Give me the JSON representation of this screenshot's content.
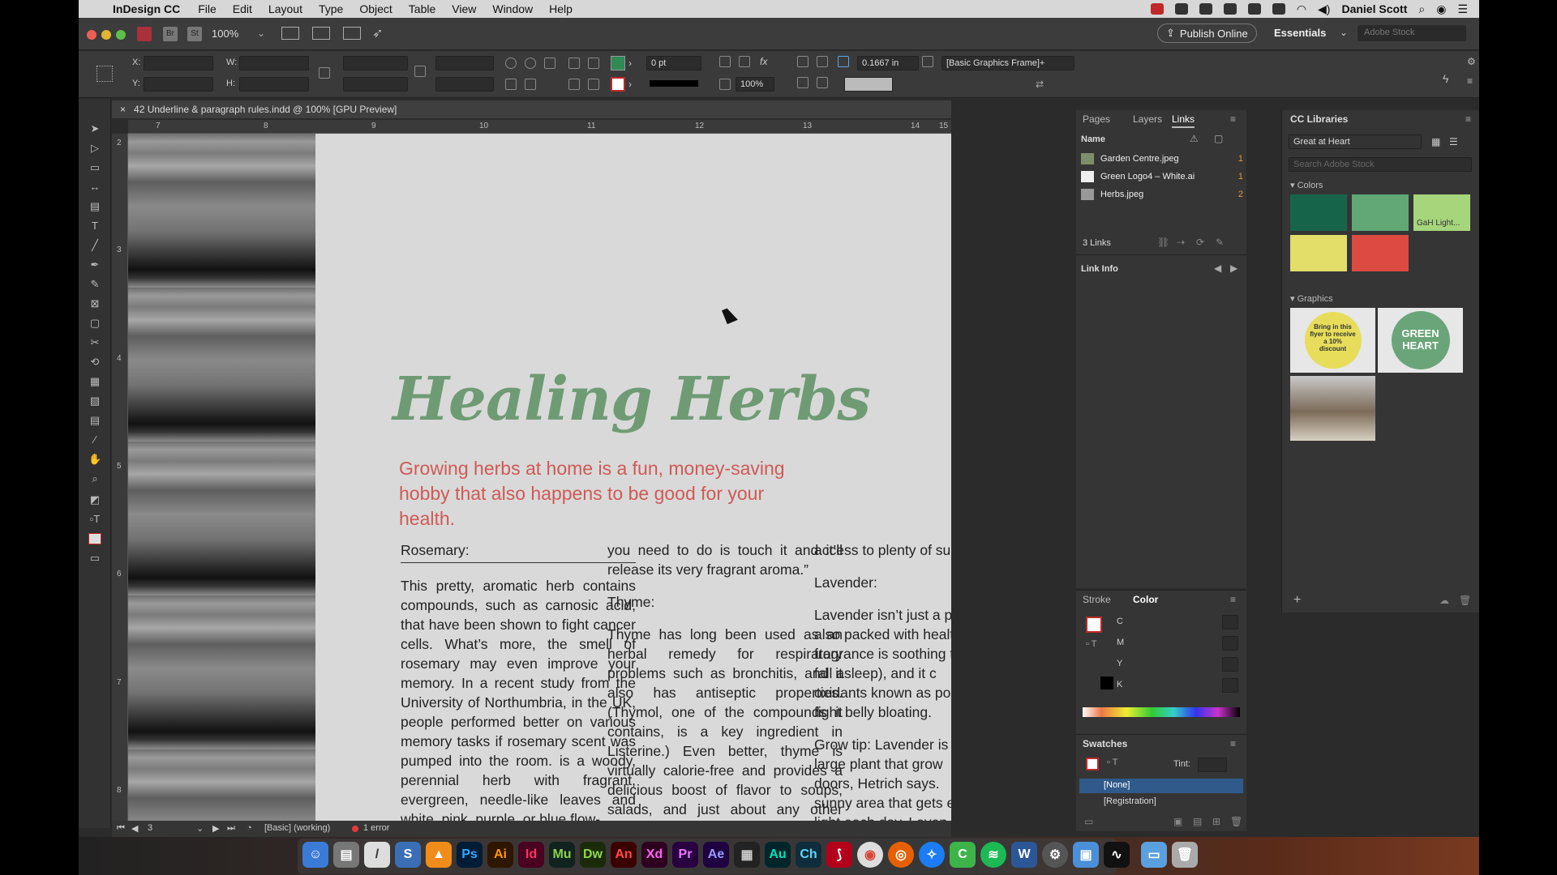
{
  "menubar": {
    "app_name": "InDesign CC",
    "items": [
      "File",
      "Edit",
      "Layout",
      "Type",
      "Object",
      "Table",
      "View",
      "Window",
      "Help"
    ],
    "user": "Daniel Scott"
  },
  "appbar": {
    "zoom": "100%",
    "publish_label": "Publish Online",
    "workspace": "Essentials",
    "stock_placeholder": "Adobe Stock"
  },
  "control": {
    "x_label": "X:",
    "y_label": "Y:",
    "w_label": "W:",
    "h_label": "H:",
    "stroke_weight": "0 pt",
    "opacity": "100%",
    "gap_value": "0.1667 in",
    "object_style": "[Basic Graphics Frame]+"
  },
  "document": {
    "tab_title": "42 Underline & paragraph rules.indd @ 100% [GPU Preview]",
    "ruler_top": [
      "7",
      "8",
      "9",
      "10",
      "11",
      "12",
      "13",
      "14",
      "15"
    ],
    "ruler_left": [
      "2",
      "3",
      "4",
      "5",
      "6",
      "7",
      "8"
    ],
    "title": "Healing Herbs",
    "subtitle": "Growing herbs at home is a fun, money-saving hobby that also happens to be good for your health.",
    "col1": {
      "heading": "Rosemary:",
      "body": "This pretty, aromatic herb contains compounds, such as carnosic acid, that have been shown to fight cancer cells. What’s more, the smell of rosemary may even improve your memory. In a recent study from the University of Northumbria, in the UK, people performed better on various memory tasks if rosemary scent was pumped into the room. is a woody, perennial herb with fragrant, evergreen, needle-like leaves and white, pink, purple, or blue flow-"
    },
    "col2": {
      "lead": "you need to do is touch it and it’ll release its very fragrant aroma.”",
      "heading": "Thyme:",
      "body": "Thyme has long been used as an herbal remedy for respiratory problems such as bronchitis, and it also has antiseptic properties. (Thymol, one of the compounds it contains, is a key ingredient in Listerine.) Even better, thyme is virtually calorie-free and provides a delicious boost of flavor to soups, salads, and just about any other recipe you can"
    },
    "col3": {
      "lead": "access to plenty of sun",
      "heading": "Lavender:",
      "body": "Lavender isn’t just a pre also packed with health fragrance is soothing to fall asleep), and it c oxidants known as poly fight belly bloating.",
      "grow_tip": "Grow tip: Lavender is large plant that grow doors, Hetrich says. sunny area that gets e light each day. Laven"
    }
  },
  "status": {
    "page": "3",
    "preflight_profile": "[Basic] (working)",
    "errors": "1 error"
  },
  "links_panel": {
    "tabs": [
      "Pages",
      "Layers",
      "Links"
    ],
    "name_header": "Name",
    "links": [
      {
        "name": "Garden Centre.jpeg",
        "page": "1"
      },
      {
        "name": "Green Logo4 – White.ai",
        "page": "1"
      },
      {
        "name": "Herbs.jpeg",
        "page": "2"
      }
    ],
    "count": "3 Links",
    "link_info": "Link Info"
  },
  "libraries": {
    "title": "CC Libraries",
    "library": "Great at Heart",
    "search_placeholder": "Search Adobe Stock",
    "colors_label": "Colors",
    "swatches": [
      "#16654a",
      "#62a877",
      "#a6d57c",
      "#e3dd6a",
      "#dc4a42"
    ],
    "swatch_tooltip": "GaH Light...",
    "graphics_label": "Graphics",
    "badge_text": "Bring in this flyer to receive a 10% discount",
    "logo_text": "GREEN HEART"
  },
  "stroke_color": {
    "tabs": [
      "Stroke",
      "Color"
    ],
    "channels": [
      "C",
      "M",
      "Y",
      "K"
    ]
  },
  "swatches_panel": {
    "title": "Swatches",
    "tint_label": "Tint:",
    "items": [
      "[None]",
      "[Registration]"
    ]
  },
  "dock": {
    "apps": [
      "Ps",
      "Ai",
      "Id",
      "Mu",
      "Dw",
      "An",
      "Xd",
      "Pr",
      "Ae",
      "Au",
      "Ch"
    ]
  }
}
